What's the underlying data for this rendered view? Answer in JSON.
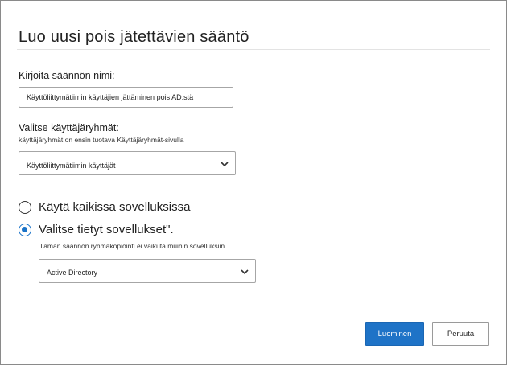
{
  "dialog": {
    "title": "Luo uusi pois jätettävien sääntö"
  },
  "rule_name": {
    "label": "Kirjoita säännön nimi:",
    "value": "Käyttöliittymätiimin käyttäjien jättäminen pois AD:stä"
  },
  "user_groups": {
    "label": "Valitse käyttäjäryhmät:",
    "sublabel": "käyttäjäryhmät on ensin tuotava Käyttäjäryhmät-sivulla",
    "selected": "Käyttöliittymätiimin käyttäjät",
    "icon": "chevron-down-icon"
  },
  "apps_scope": {
    "option_all": "Käytä kaikissa sovelluksissa",
    "option_specific": "Valitse tietyt sovellukset\".",
    "selected_option": "specific",
    "note": "Tämän säännön ryhmäkopiointi ei vaikuta muihin sovelluksiin",
    "app_selected": "Active Directory",
    "icon": "chevron-down-icon"
  },
  "buttons": {
    "create": "Luominen",
    "cancel": "Peruuta"
  },
  "colors": {
    "accent": "#1e73c7",
    "border": "#a6a6a6"
  }
}
